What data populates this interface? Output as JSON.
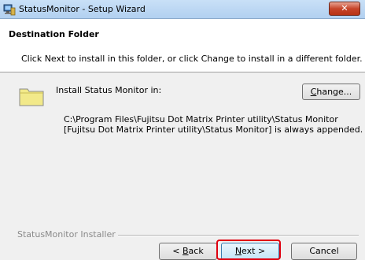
{
  "window": {
    "title": "StatusMonitor - Setup Wizard",
    "close_label": "✕"
  },
  "header": {
    "title": "Destination Folder",
    "description": "Click Next to install in this folder, or click Change to install in a different folder."
  },
  "content": {
    "install_label": "Install Status Monitor in:",
    "change_prefix": "",
    "change_key": "C",
    "change_suffix": "hange...",
    "path": "C:\\Program Files\\Fujitsu Dot Matrix Printer utility\\Status Monitor",
    "append_note": "[Fujitsu Dot Matrix Printer utility\\Status Monitor] is always appended."
  },
  "footer": {
    "brand": "StatusMonitor Installer",
    "back_prefix": "< ",
    "back_key": "B",
    "back_suffix": "ack",
    "next_prefix": "",
    "next_key": "N",
    "next_suffix": "ext >",
    "cancel_label": "Cancel"
  },
  "colors": {
    "highlight": "#e0000f",
    "folder": "#f2e98a"
  }
}
